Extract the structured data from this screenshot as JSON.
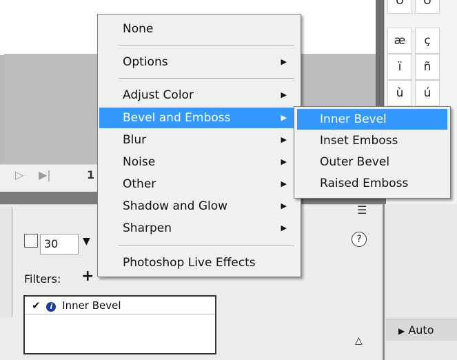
{
  "menu": {
    "items": [
      {
        "label": "None",
        "has_submenu": false
      },
      {
        "label": "Options",
        "has_submenu": true
      },
      {
        "label": "Adjust Color",
        "has_submenu": true
      },
      {
        "label": "Bevel and Emboss",
        "has_submenu": true,
        "highlighted": true
      },
      {
        "label": "Blur",
        "has_submenu": true
      },
      {
        "label": "Noise",
        "has_submenu": true
      },
      {
        "label": "Other",
        "has_submenu": true
      },
      {
        "label": "Shadow and Glow",
        "has_submenu": true
      },
      {
        "label": "Sharpen",
        "has_submenu": true
      },
      {
        "label": "Photoshop Live Effects",
        "has_submenu": false
      }
    ],
    "submenu_arrow": "▶"
  },
  "submenu": {
    "items": [
      {
        "label": "Inner Bevel",
        "highlighted": true
      },
      {
        "label": "Inset Emboss"
      },
      {
        "label": "Outer Bevel"
      },
      {
        "label": "Raised Emboss"
      }
    ]
  },
  "char_panel": {
    "rows": [
      [
        "Ü",
        "Ü"
      ],
      [
        "æ",
        "ç"
      ],
      [
        "ï",
        "ñ"
      ],
      [
        "ù",
        "ú"
      ]
    ]
  },
  "timeline": {
    "play_icon": "▷",
    "step_icon": "▶|",
    "frame_number": "1"
  },
  "properties": {
    "value": "30",
    "dropdown_icon": "▼",
    "filters_label": "Filters:",
    "add_icon": "+",
    "filter_entry": {
      "check": "✔",
      "info": "i",
      "label": "Inner Bevel"
    }
  },
  "panel_icons": {
    "options": "☰",
    "help": "?",
    "collapse": "△"
  },
  "auto_bar": {
    "arrow": "▶",
    "label": "Auto"
  },
  "colors": {
    "highlight": "#3399ff",
    "menu_bg": "#f0f0f0"
  }
}
